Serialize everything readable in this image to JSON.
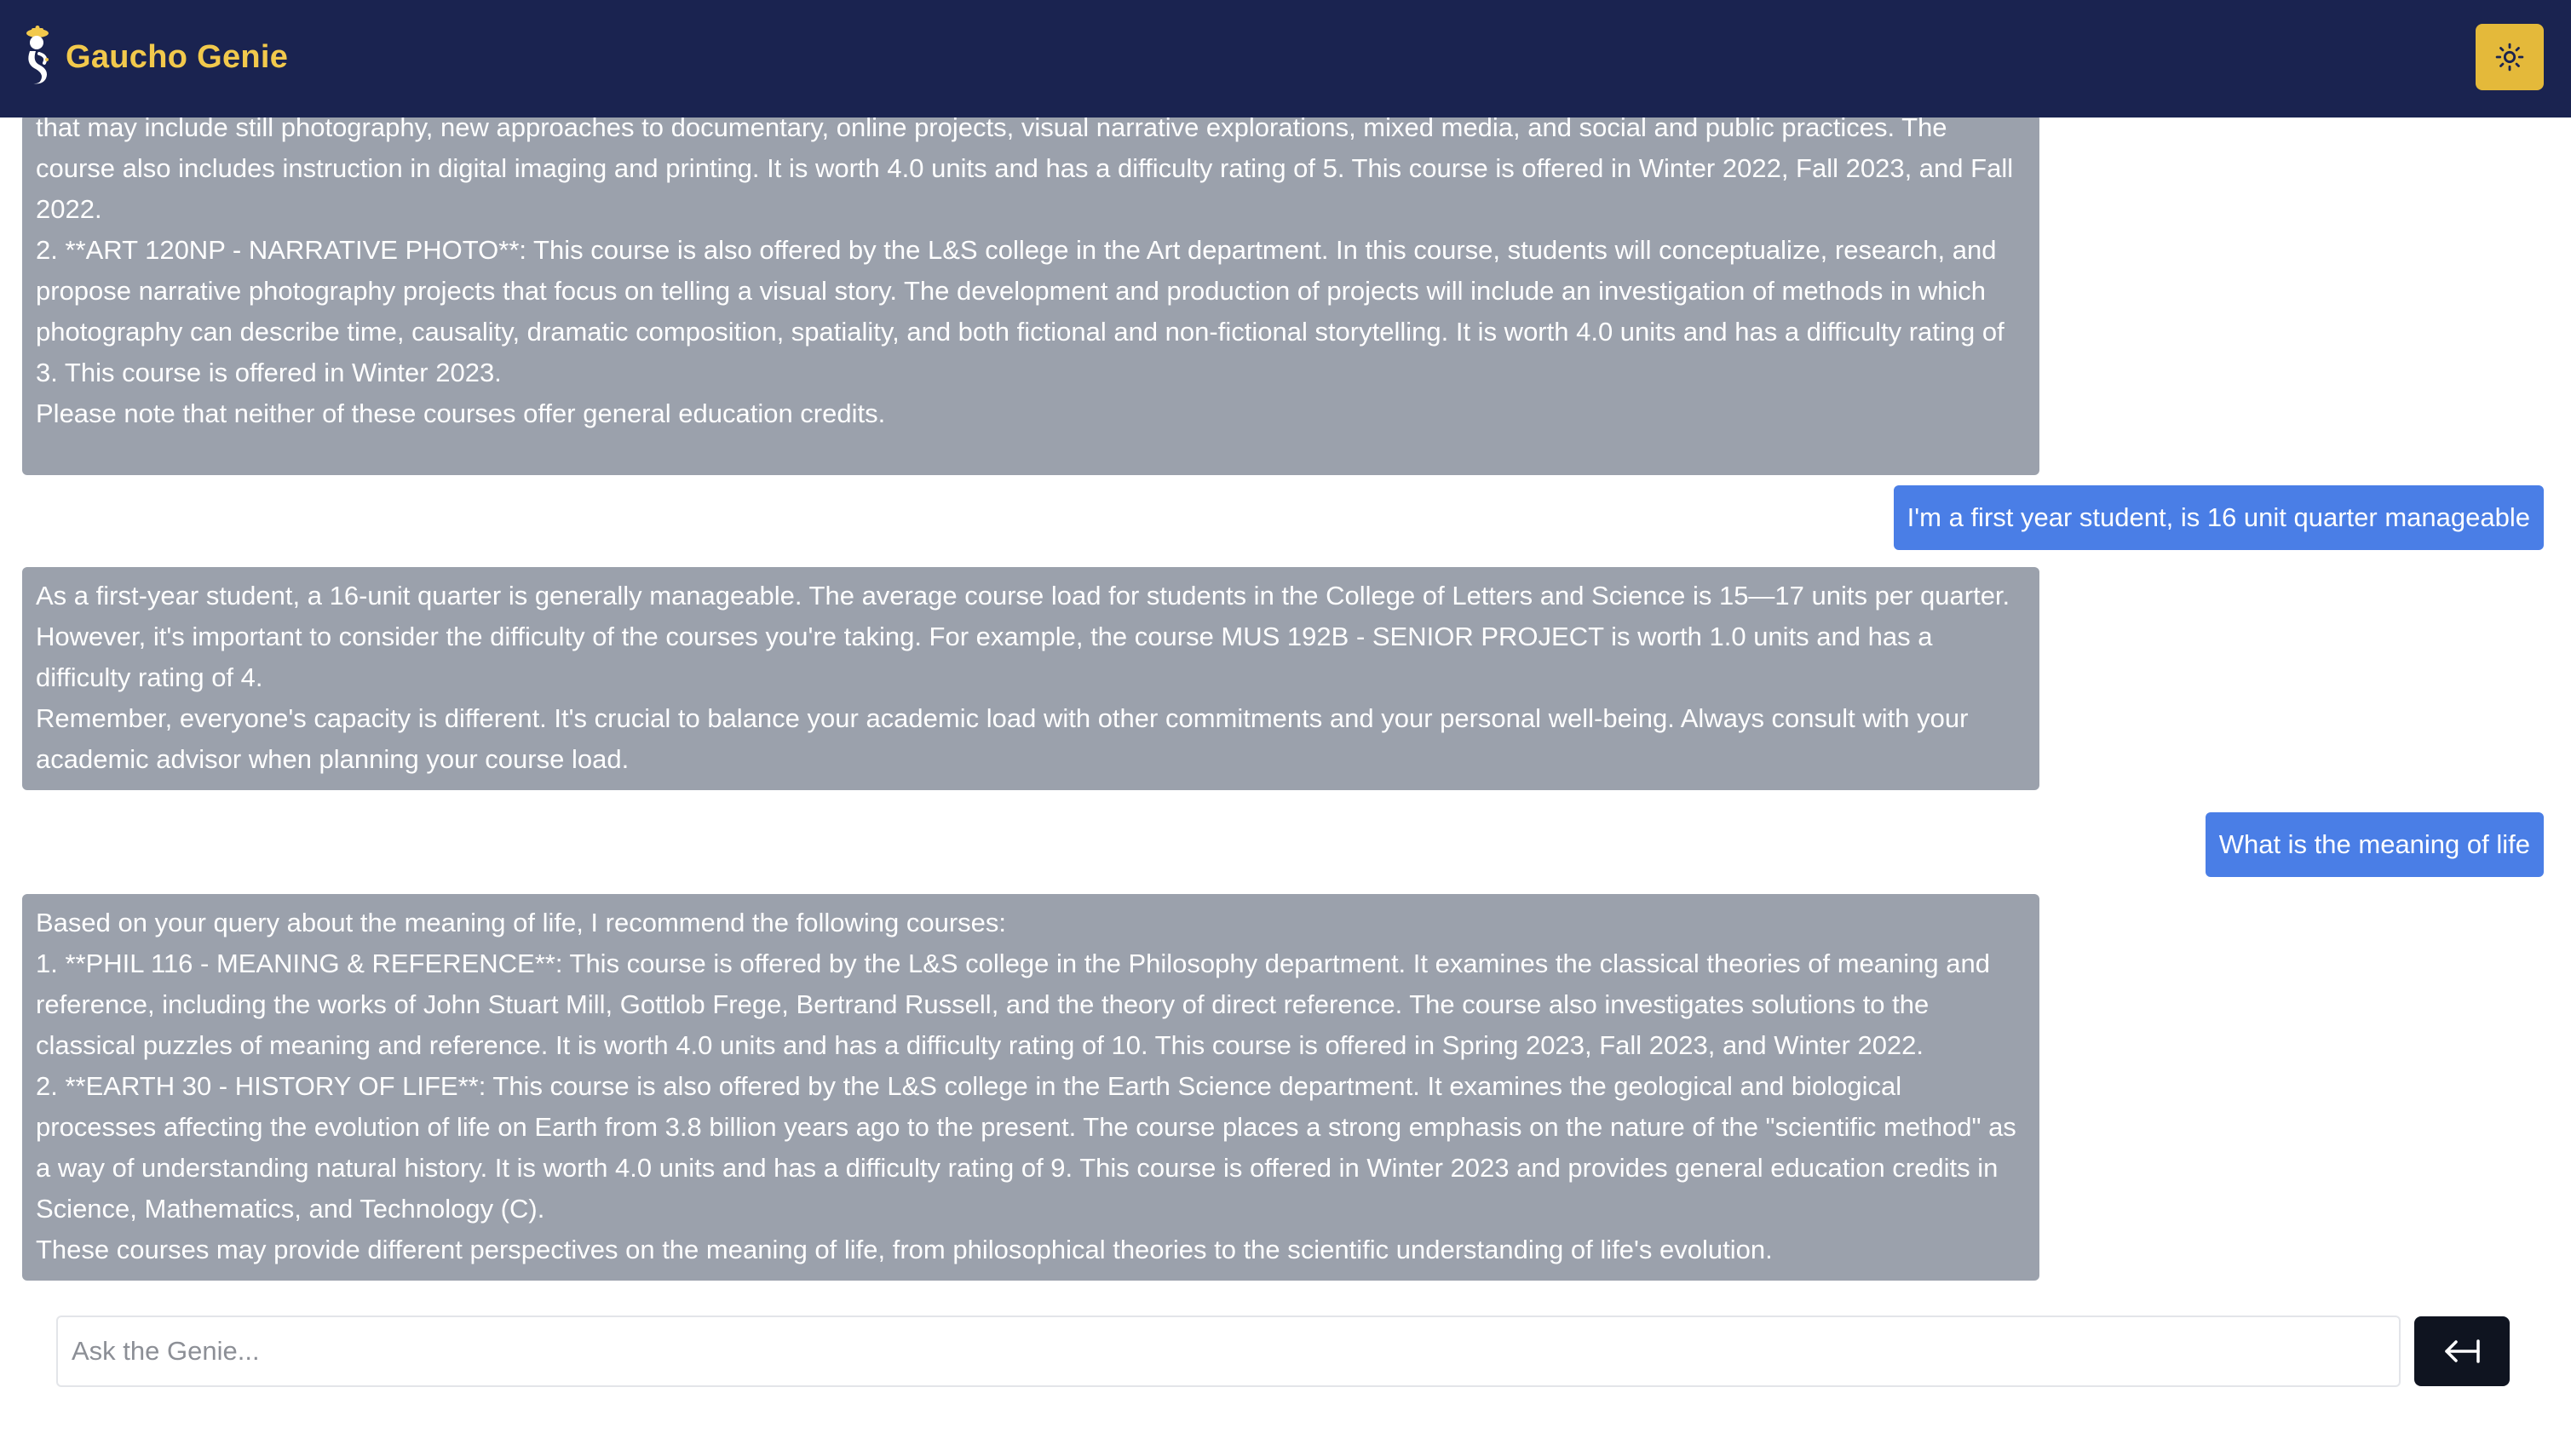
{
  "app": {
    "title": "Gaucho Genie",
    "brand_color": "#f2c94c",
    "header_color": "#1a2350"
  },
  "header": {
    "logo_icon": "genie-icon",
    "theme_toggle_icon": "sun-icon"
  },
  "messages": [
    {
      "role": "assistant",
      "lines": [
        "that may include still photography, new approaches to documentary, online projects, visual narrative explorations, mixed media, and social and public practices. The course also includes instruction in digital imaging and printing. It is worth 4.0 units and has a difficulty rating of 5. This course is offered in Winter 2022, Fall 2023, and Fall 2022.",
        "2. **ART 120NP - NARRATIVE PHOTO**: This course is also offered by the L&S college in the Art department. In this course, students will conceptualize, research, and propose narrative photography projects that focus on telling a visual story. The development and production of projects will include an investigation of methods in which photography can describe time, causality, dramatic composition, spatiality, and both fictional and non-fictional storytelling. It is worth 4.0 units and has a difficulty rating of 3. This course is offered in Winter 2023.",
        "Please note that neither of these courses offer general education credits."
      ]
    },
    {
      "role": "user",
      "text": "I'm a first year student, is 16 unit quarter manageable"
    },
    {
      "role": "assistant",
      "lines": [
        "As a first-year student, a 16-unit quarter is generally manageable. The average course load for students in the College of Letters and Science is 15—17 units per quarter. However, it's important to consider the difficulty of the courses you're taking. For example, the course MUS 192B - SENIOR PROJECT is worth 1.0 units and has a difficulty rating of 4.",
        "Remember, everyone's capacity is different. It's crucial to balance your academic load with other commitments and your personal well-being. Always consult with your academic advisor when planning your course load."
      ]
    },
    {
      "role": "user",
      "text": "What is the meaning of life"
    },
    {
      "role": "assistant",
      "lines": [
        "Based on your query about the meaning of life, I recommend the following courses:",
        "1. **PHIL 116 - MEANING & REFERENCE**: This course is offered by the L&S college in the Philosophy department. It examines the classical theories of meaning and reference, including the works of John Stuart Mill, Gottlob Frege, Bertrand Russell, and the theory of direct reference. The course also investigates solutions to the classical puzzles of meaning and reference. It is worth 4.0 units and has a difficulty rating of 10. This course is offered in Spring 2023, Fall 2023, and Winter 2022.",
        "2. **EARTH 30 - HISTORY OF LIFE**: This course is also offered by the L&S college in the Earth Science department. It examines the geological and biological processes affecting the evolution of life on Earth from 3.8 billion years ago to the present. The course places a strong emphasis on the nature of the \"scientific method\" as a way of understanding natural history. It is worth 4.0 units and has a difficulty rating of 9. This course is offered in Winter 2023 and provides general education credits in Science, Mathematics, and Technology (C).",
        "These courses may provide different perspectives on the meaning of life, from philosophical theories to the scientific understanding of life's evolution."
      ]
    }
  ],
  "composer": {
    "placeholder": "Ask the Genie...",
    "value": "",
    "send_icon": "send-arrow-icon"
  },
  "colors": {
    "assistant_bubble": "#9ba1ac",
    "user_bubble": "#4a7ee6",
    "send_button": "#0f1420",
    "theme_button": "#e4b93a"
  }
}
